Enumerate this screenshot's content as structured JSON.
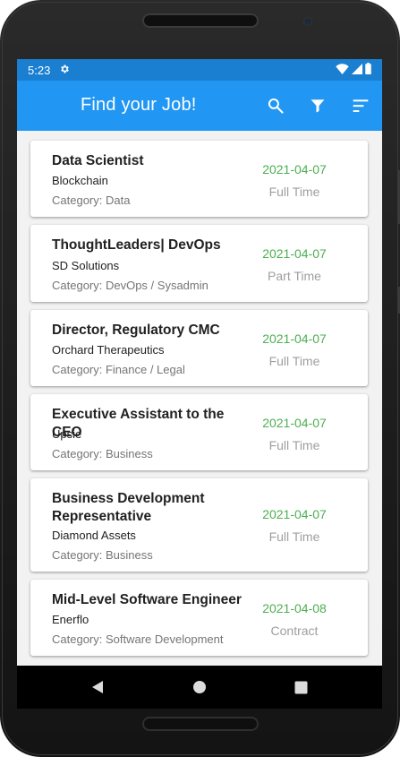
{
  "status_bar": {
    "time": "5:23",
    "settings_icon": "gear-icon",
    "wifi_icon": "wifi-icon",
    "signal_icon": "signal-icon",
    "battery_icon": "battery-icon"
  },
  "app_bar": {
    "title": "Find your Job!",
    "actions": [
      "search-icon",
      "filter-icon",
      "sort-icon"
    ]
  },
  "colors": {
    "app_bar": "#2196f3",
    "status_bar": "#1a7fd1",
    "date": "#4caf50",
    "job_type": "#9e9e9e"
  },
  "jobs": [
    {
      "title": "Data Scientist",
      "company": "Blockchain",
      "category": "Category: Data",
      "date": "2021-04-07",
      "type": "Full Time"
    },
    {
      "title": "ThoughtLeaders| DevOps",
      "company": "SD Solutions",
      "category": "Category: DevOps / Sysadmin",
      "date": "2021-04-07",
      "type": "Part Time"
    },
    {
      "title": "Director, Regulatory CMC",
      "company": "Orchard Therapeutics",
      "category": "Category: Finance / Legal",
      "date": "2021-04-07",
      "type": "Full Time"
    },
    {
      "title": "Executive Assistant to the CEO",
      "company": "Upsie",
      "category": "Category: Business",
      "date": "2021-04-07",
      "type": "Full Time"
    },
    {
      "title": "Business Development Representative",
      "company": "Diamond Assets",
      "category": "Category: Business",
      "date": "2021-04-07",
      "type": "Full Time"
    },
    {
      "title": "Mid-Level Software Engineer",
      "company": "Enerflo",
      "category": "Category: Software Development",
      "date": "2021-04-08",
      "type": "Contract"
    }
  ],
  "nav_bar": {
    "back_icon": "back-triangle-icon",
    "home_icon": "home-circle-icon",
    "recents_icon": "recents-square-icon"
  }
}
